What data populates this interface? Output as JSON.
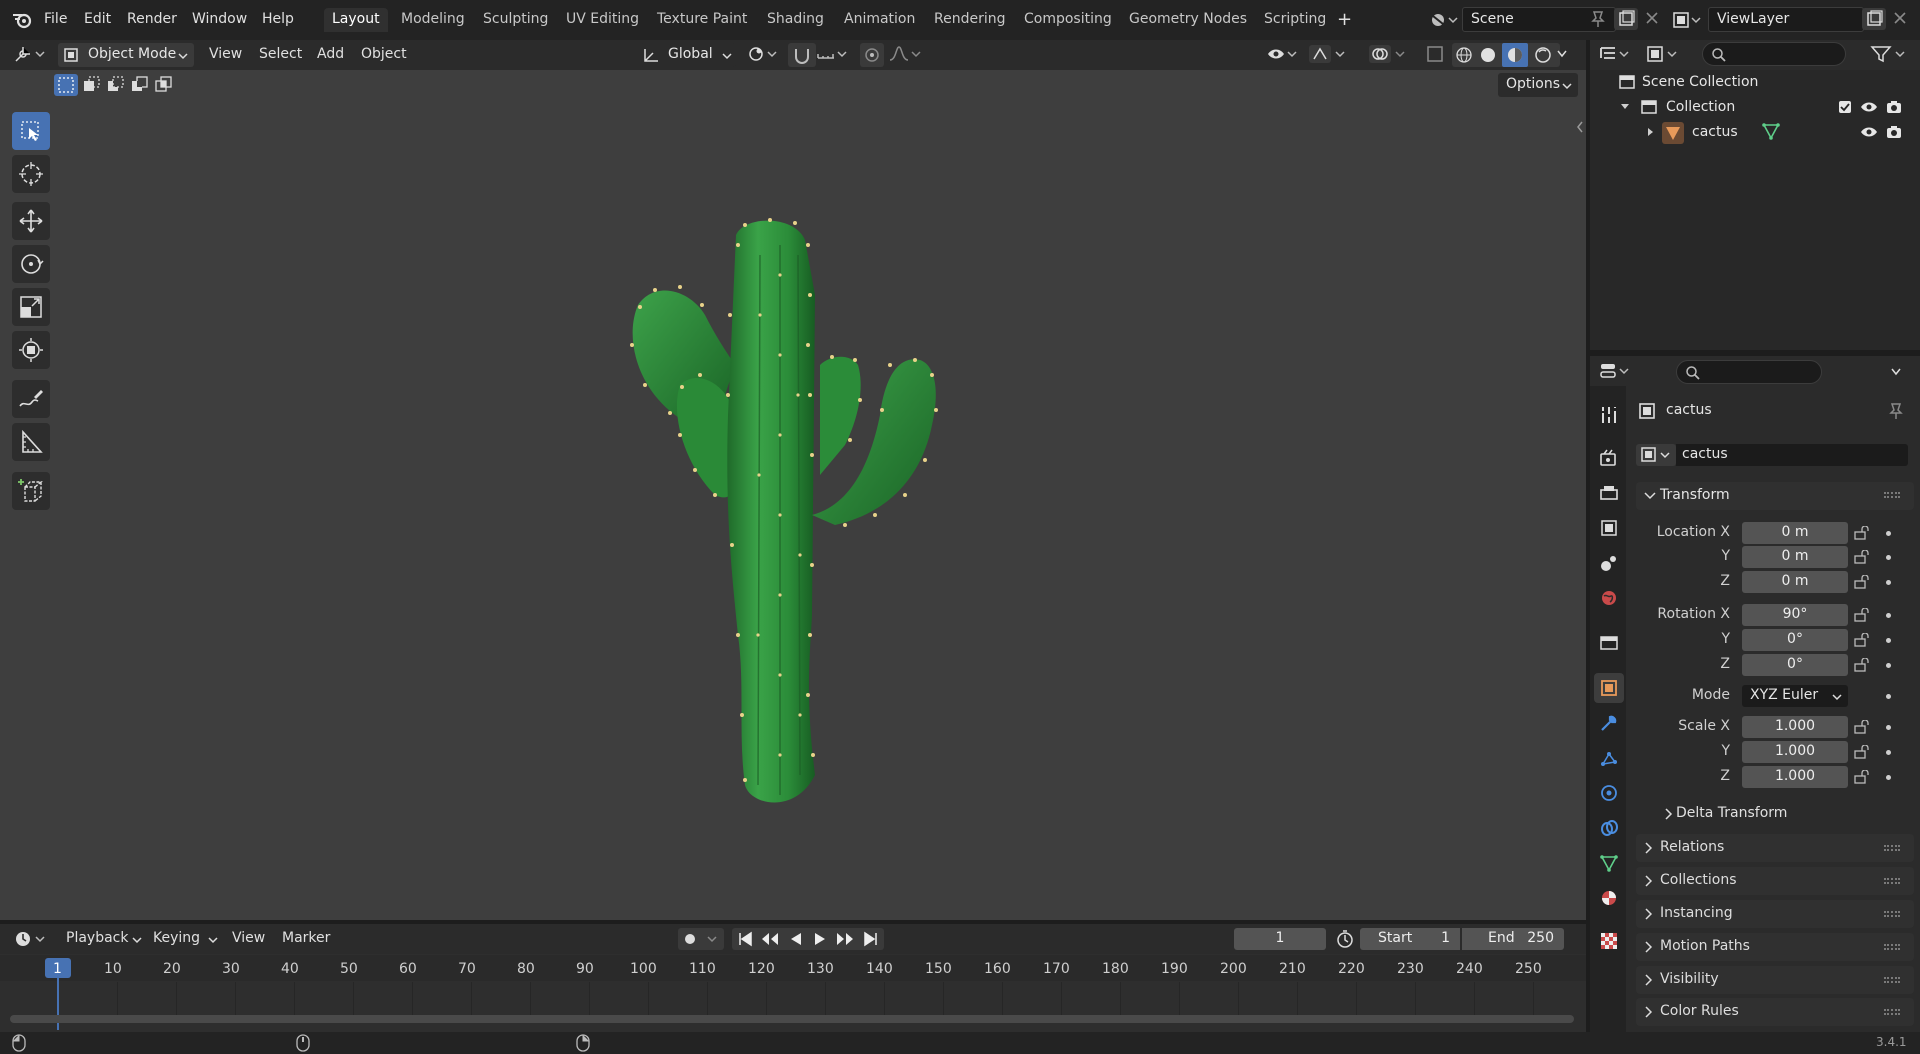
{
  "menus": [
    "File",
    "Edit",
    "Render",
    "Window",
    "Help"
  ],
  "workspace_tabs": [
    "Layout",
    "Modeling",
    "Sculpting",
    "UV Editing",
    "Texture Paint",
    "Shading",
    "Animation",
    "Rendering",
    "Compositing",
    "Geometry Nodes",
    "Scripting"
  ],
  "active_tab": "Layout",
  "add_tab_label": "+",
  "scene": {
    "name": "Scene",
    "view_layer": "ViewLayer"
  },
  "viewport": {
    "mode": "Object Mode",
    "menus": [
      "View",
      "Select",
      "Add",
      "Object"
    ],
    "orientation": "Global",
    "options_label": "Options"
  },
  "outliner": {
    "root": "Scene Collection",
    "collection": "Collection",
    "object": "cactus"
  },
  "properties": {
    "object_name": "cactus",
    "data_name": "cactus",
    "section": "Transform",
    "location": {
      "label": "Location X",
      "x": "0 m",
      "y": "0 m",
      "z": "0 m"
    },
    "rotation": {
      "label": "Rotation X",
      "x": "90°",
      "y": "0°",
      "z": "0°"
    },
    "mode_label": "Mode",
    "mode_value": "XYZ Euler",
    "scale": {
      "label": "Scale X",
      "x": "1.000",
      "y": "1.000",
      "z": "1.000"
    },
    "axis_y": "Y",
    "axis_z": "Z",
    "delta": "Delta Transform",
    "panels": [
      "Relations",
      "Collections",
      "Instancing",
      "Motion Paths",
      "Visibility",
      "Color Rules"
    ]
  },
  "timeline": {
    "menus": [
      "Playback",
      "Keying",
      "View",
      "Marker"
    ],
    "current_frame": "1",
    "start_label": "Start",
    "start": "1",
    "end_label": "End",
    "end": "250",
    "ticks": [
      "1",
      "10",
      "20",
      "30",
      "40",
      "50",
      "60",
      "70",
      "80",
      "90",
      "100",
      "110",
      "120",
      "130",
      "140",
      "150",
      "160",
      "170",
      "180",
      "190",
      "200",
      "210",
      "220",
      "230",
      "240",
      "250"
    ]
  },
  "version": "3.4.1",
  "colors": {
    "accent": "#4772b3",
    "cactus": "#2e8b3a",
    "spine": "#e8d28a"
  }
}
